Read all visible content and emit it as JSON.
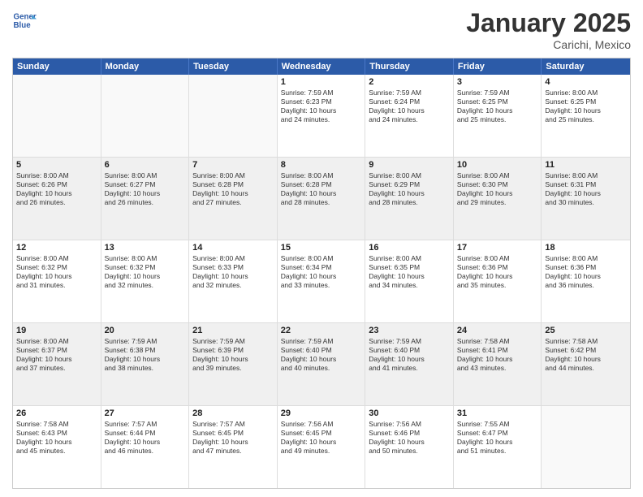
{
  "header": {
    "logo_line1": "General",
    "logo_line2": "Blue",
    "month": "January 2025",
    "location": "Carichi, Mexico"
  },
  "weekdays": [
    "Sunday",
    "Monday",
    "Tuesday",
    "Wednesday",
    "Thursday",
    "Friday",
    "Saturday"
  ],
  "rows": [
    [
      {
        "day": "",
        "text": ""
      },
      {
        "day": "",
        "text": ""
      },
      {
        "day": "",
        "text": ""
      },
      {
        "day": "1",
        "text": "Sunrise: 7:59 AM\nSunset: 6:23 PM\nDaylight: 10 hours\nand 24 minutes."
      },
      {
        "day": "2",
        "text": "Sunrise: 7:59 AM\nSunset: 6:24 PM\nDaylight: 10 hours\nand 24 minutes."
      },
      {
        "day": "3",
        "text": "Sunrise: 7:59 AM\nSunset: 6:25 PM\nDaylight: 10 hours\nand 25 minutes."
      },
      {
        "day": "4",
        "text": "Sunrise: 8:00 AM\nSunset: 6:25 PM\nDaylight: 10 hours\nand 25 minutes."
      }
    ],
    [
      {
        "day": "5",
        "text": "Sunrise: 8:00 AM\nSunset: 6:26 PM\nDaylight: 10 hours\nand 26 minutes."
      },
      {
        "day": "6",
        "text": "Sunrise: 8:00 AM\nSunset: 6:27 PM\nDaylight: 10 hours\nand 26 minutes."
      },
      {
        "day": "7",
        "text": "Sunrise: 8:00 AM\nSunset: 6:28 PM\nDaylight: 10 hours\nand 27 minutes."
      },
      {
        "day": "8",
        "text": "Sunrise: 8:00 AM\nSunset: 6:28 PM\nDaylight: 10 hours\nand 28 minutes."
      },
      {
        "day": "9",
        "text": "Sunrise: 8:00 AM\nSunset: 6:29 PM\nDaylight: 10 hours\nand 28 minutes."
      },
      {
        "day": "10",
        "text": "Sunrise: 8:00 AM\nSunset: 6:30 PM\nDaylight: 10 hours\nand 29 minutes."
      },
      {
        "day": "11",
        "text": "Sunrise: 8:00 AM\nSunset: 6:31 PM\nDaylight: 10 hours\nand 30 minutes."
      }
    ],
    [
      {
        "day": "12",
        "text": "Sunrise: 8:00 AM\nSunset: 6:32 PM\nDaylight: 10 hours\nand 31 minutes."
      },
      {
        "day": "13",
        "text": "Sunrise: 8:00 AM\nSunset: 6:32 PM\nDaylight: 10 hours\nand 32 minutes."
      },
      {
        "day": "14",
        "text": "Sunrise: 8:00 AM\nSunset: 6:33 PM\nDaylight: 10 hours\nand 32 minutes."
      },
      {
        "day": "15",
        "text": "Sunrise: 8:00 AM\nSunset: 6:34 PM\nDaylight: 10 hours\nand 33 minutes."
      },
      {
        "day": "16",
        "text": "Sunrise: 8:00 AM\nSunset: 6:35 PM\nDaylight: 10 hours\nand 34 minutes."
      },
      {
        "day": "17",
        "text": "Sunrise: 8:00 AM\nSunset: 6:36 PM\nDaylight: 10 hours\nand 35 minutes."
      },
      {
        "day": "18",
        "text": "Sunrise: 8:00 AM\nSunset: 6:36 PM\nDaylight: 10 hours\nand 36 minutes."
      }
    ],
    [
      {
        "day": "19",
        "text": "Sunrise: 8:00 AM\nSunset: 6:37 PM\nDaylight: 10 hours\nand 37 minutes."
      },
      {
        "day": "20",
        "text": "Sunrise: 7:59 AM\nSunset: 6:38 PM\nDaylight: 10 hours\nand 38 minutes."
      },
      {
        "day": "21",
        "text": "Sunrise: 7:59 AM\nSunset: 6:39 PM\nDaylight: 10 hours\nand 39 minutes."
      },
      {
        "day": "22",
        "text": "Sunrise: 7:59 AM\nSunset: 6:40 PM\nDaylight: 10 hours\nand 40 minutes."
      },
      {
        "day": "23",
        "text": "Sunrise: 7:59 AM\nSunset: 6:40 PM\nDaylight: 10 hours\nand 41 minutes."
      },
      {
        "day": "24",
        "text": "Sunrise: 7:58 AM\nSunset: 6:41 PM\nDaylight: 10 hours\nand 43 minutes."
      },
      {
        "day": "25",
        "text": "Sunrise: 7:58 AM\nSunset: 6:42 PM\nDaylight: 10 hours\nand 44 minutes."
      }
    ],
    [
      {
        "day": "26",
        "text": "Sunrise: 7:58 AM\nSunset: 6:43 PM\nDaylight: 10 hours\nand 45 minutes."
      },
      {
        "day": "27",
        "text": "Sunrise: 7:57 AM\nSunset: 6:44 PM\nDaylight: 10 hours\nand 46 minutes."
      },
      {
        "day": "28",
        "text": "Sunrise: 7:57 AM\nSunset: 6:45 PM\nDaylight: 10 hours\nand 47 minutes."
      },
      {
        "day": "29",
        "text": "Sunrise: 7:56 AM\nSunset: 6:45 PM\nDaylight: 10 hours\nand 49 minutes."
      },
      {
        "day": "30",
        "text": "Sunrise: 7:56 AM\nSunset: 6:46 PM\nDaylight: 10 hours\nand 50 minutes."
      },
      {
        "day": "31",
        "text": "Sunrise: 7:55 AM\nSunset: 6:47 PM\nDaylight: 10 hours\nand 51 minutes."
      },
      {
        "day": "",
        "text": ""
      }
    ]
  ]
}
